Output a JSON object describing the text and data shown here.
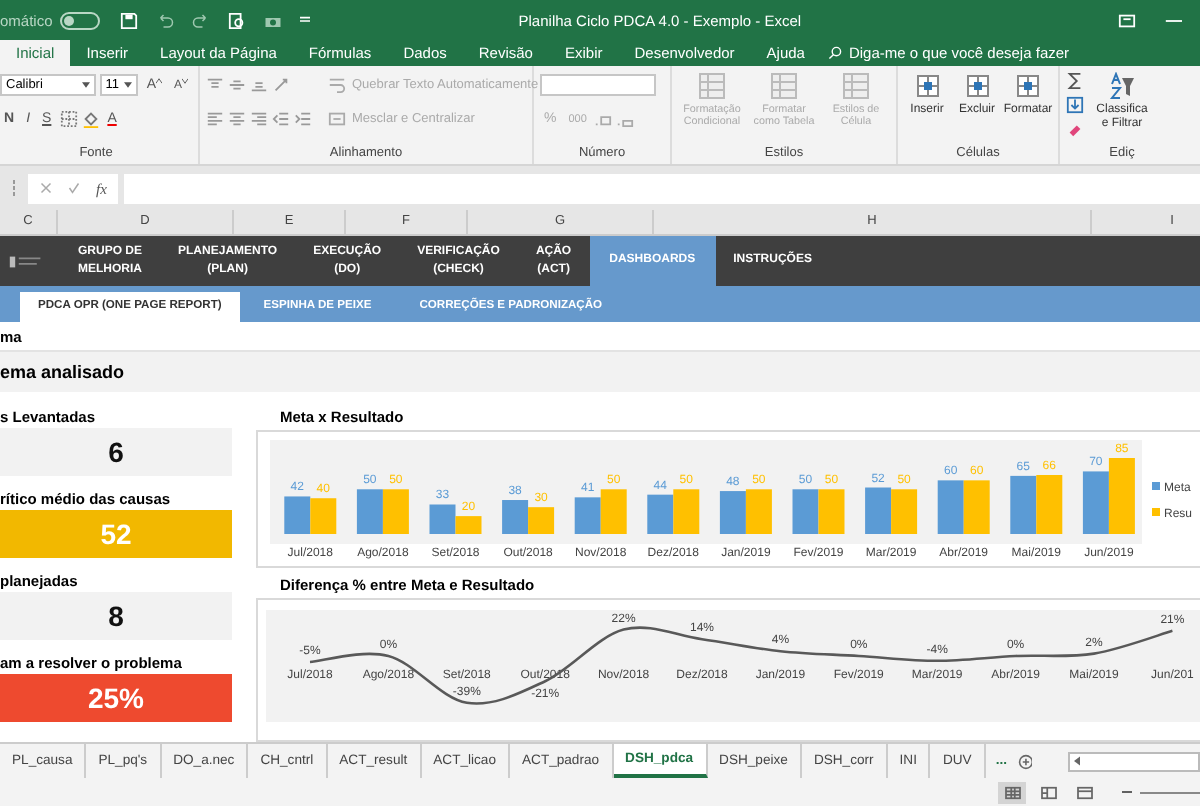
{
  "titlebar": {
    "autosave": {
      "label": "omático",
      "on": false
    },
    "title": "Planilha Ciclo PDCA 4.0 - Exemplo - Excel"
  },
  "menu": {
    "tabs": [
      {
        "label": "Inicial",
        "selected": true
      },
      {
        "label": "Inserir",
        "selected": false
      },
      {
        "label": "Layout da Página",
        "selected": false
      },
      {
        "label": "Fórmulas",
        "selected": false
      },
      {
        "label": "Dados",
        "selected": false
      },
      {
        "label": "Revisão",
        "selected": false
      },
      {
        "label": "Exibir",
        "selected": false
      },
      {
        "label": "Desenvolvedor",
        "selected": false
      },
      {
        "label": "Ajuda",
        "selected": false
      }
    ],
    "search": {
      "placeholder": "Diga-me o que você deseja fazer"
    }
  },
  "ribbon": {
    "font": {
      "title": "Fonte",
      "name": "Calibri",
      "size": "11",
      "grow": "A",
      "shrink": "A",
      "styles": [
        "N",
        "I",
        "S"
      ],
      "color_button": "A"
    },
    "alignment": {
      "title": "Alinhamento",
      "wrap": {
        "label": "Quebrar Texto Automaticamente",
        "disabled": true
      },
      "merge": {
        "label": "Mesclar e Centralizar",
        "disabled": true
      }
    },
    "number": {
      "title": "Número",
      "percent": "%",
      "thousands": "000"
    },
    "styles": {
      "title": "Estilos",
      "buttons": [
        {
          "label": "Formatação Condicional",
          "disabled": true
        },
        {
          "label": "Formatar como Tabela",
          "disabled": true
        },
        {
          "label": "Estilos de Célula",
          "disabled": true
        }
      ]
    },
    "cells": {
      "title": "Células",
      "buttons": [
        {
          "label": "Inserir",
          "disabled": false
        },
        {
          "label": "Excluir",
          "disabled": false
        },
        {
          "label": "Formatar",
          "disabled": false
        }
      ]
    },
    "editing": {
      "title": "Ediç",
      "sort": [
        "Classifica",
        "e Filtrar"
      ]
    }
  },
  "formula_bar": {
    "function_label": "fx"
  },
  "columns": [
    "C",
    "D",
    "E",
    "F",
    "G",
    "H",
    "I"
  ],
  "nav": [
    {
      "lines": [
        "GRUPO DE",
        "MELHORIA"
      ],
      "selected": false
    },
    {
      "lines": [
        "PLANEJAMENTO",
        "(PLAN)"
      ],
      "selected": false
    },
    {
      "lines": [
        "EXECUÇÃO",
        "(DO)"
      ],
      "selected": false
    },
    {
      "lines": [
        "VERIFICAÇÃO",
        "(CHECK)"
      ],
      "selected": false
    },
    {
      "lines": [
        "AÇÃO",
        "(ACT)"
      ],
      "selected": false
    },
    {
      "lines": [
        "DASHBOARDS"
      ],
      "selected": true
    },
    {
      "lines": [
        "INSTRUÇÕES"
      ],
      "selected": false
    }
  ],
  "subtabs": [
    {
      "label": "PDCA OPR (ONE PAGE REPORT)",
      "selected": true
    },
    {
      "label": "ESPINHA DE PEIXE",
      "selected": false
    },
    {
      "label": "CORREÇÕES E PADRONIZAÇÃO",
      "selected": false
    }
  ],
  "sheet_rows": {
    "title": "ma",
    "subtitle": "ema analisado"
  },
  "kpis": [
    {
      "label": "s Levantadas",
      "value": "6",
      "color": "#f2f2f2"
    },
    {
      "label": "rítico médio das causas",
      "value": "52",
      "color": "#f2b800"
    },
    {
      "label": "planejadas",
      "value": "8",
      "color": "#f2f2f2"
    },
    {
      "label": "am a resolver o problema",
      "value": "25%",
      "color": "#ee4a2f"
    }
  ],
  "bar_chart": {
    "chart_data": {
      "type": "bar",
      "title": "Meta x Resultado",
      "categories": [
        "Jul/2018",
        "Ago/2018",
        "Set/2018",
        "Out/2018",
        "Nov/2018",
        "Dez/2018",
        "Jan/2019",
        "Fev/2019",
        "Mar/2019",
        "Abr/2019",
        "Mai/2019",
        "Jun/2019"
      ],
      "series": [
        {
          "name": "Meta",
          "color": "#5b9bd5",
          "values": [
            42,
            50,
            33,
            38,
            41,
            44,
            48,
            50,
            52,
            60,
            65,
            70
          ]
        },
        {
          "name": "Resu",
          "color": "#ffc000",
          "values": [
            40,
            50,
            20,
            30,
            50,
            50,
            50,
            50,
            50,
            60,
            66,
            85
          ]
        }
      ],
      "data_labels": true,
      "legend": "right"
    }
  },
  "line_chart": {
    "chart_data": {
      "type": "line",
      "title": "Diferença % entre Meta e Resultado",
      "categories": [
        "Jul/2018",
        "Ago/2018",
        "Set/2018",
        "Out/2018",
        "Nov/2018",
        "Dez/2018",
        "Jan/2019",
        "Fev/2019",
        "Mar/2019",
        "Abr/2019",
        "Mai/2019",
        "Jun/201"
      ],
      "series": [
        {
          "color": "#595959",
          "values": [
            -5,
            0,
            -39,
            -21,
            22,
            14,
            4,
            0,
            -4,
            0,
            2,
            21
          ],
          "value_labels": [
            "-5%",
            "0%",
            "-39%",
            "-21%",
            "22%",
            "14%",
            "4%",
            "0%",
            "-4%",
            "0%",
            "2%",
            "21%"
          ]
        }
      ]
    }
  },
  "sheet_tabs": [
    {
      "label": "PL_causa",
      "selected": false
    },
    {
      "label": "PL_pq's",
      "selected": false
    },
    {
      "label": "DO_a.nec",
      "selected": false
    },
    {
      "label": "CH_cntrl",
      "selected": false
    },
    {
      "label": "ACT_result",
      "selected": false
    },
    {
      "label": "ACT_licao",
      "selected": false
    },
    {
      "label": "ACT_padrao",
      "selected": false
    },
    {
      "label": "DSH_pdca",
      "selected": true
    },
    {
      "label": "DSH_peixe",
      "selected": false
    },
    {
      "label": "DSH_corr",
      "selected": false
    },
    {
      "label": "INI",
      "selected": false
    },
    {
      "label": "DUV",
      "selected": false
    }
  ],
  "more_tabs": "...",
  "views": [
    {
      "selected": true
    },
    {
      "selected": false
    },
    {
      "selected": false
    }
  ]
}
